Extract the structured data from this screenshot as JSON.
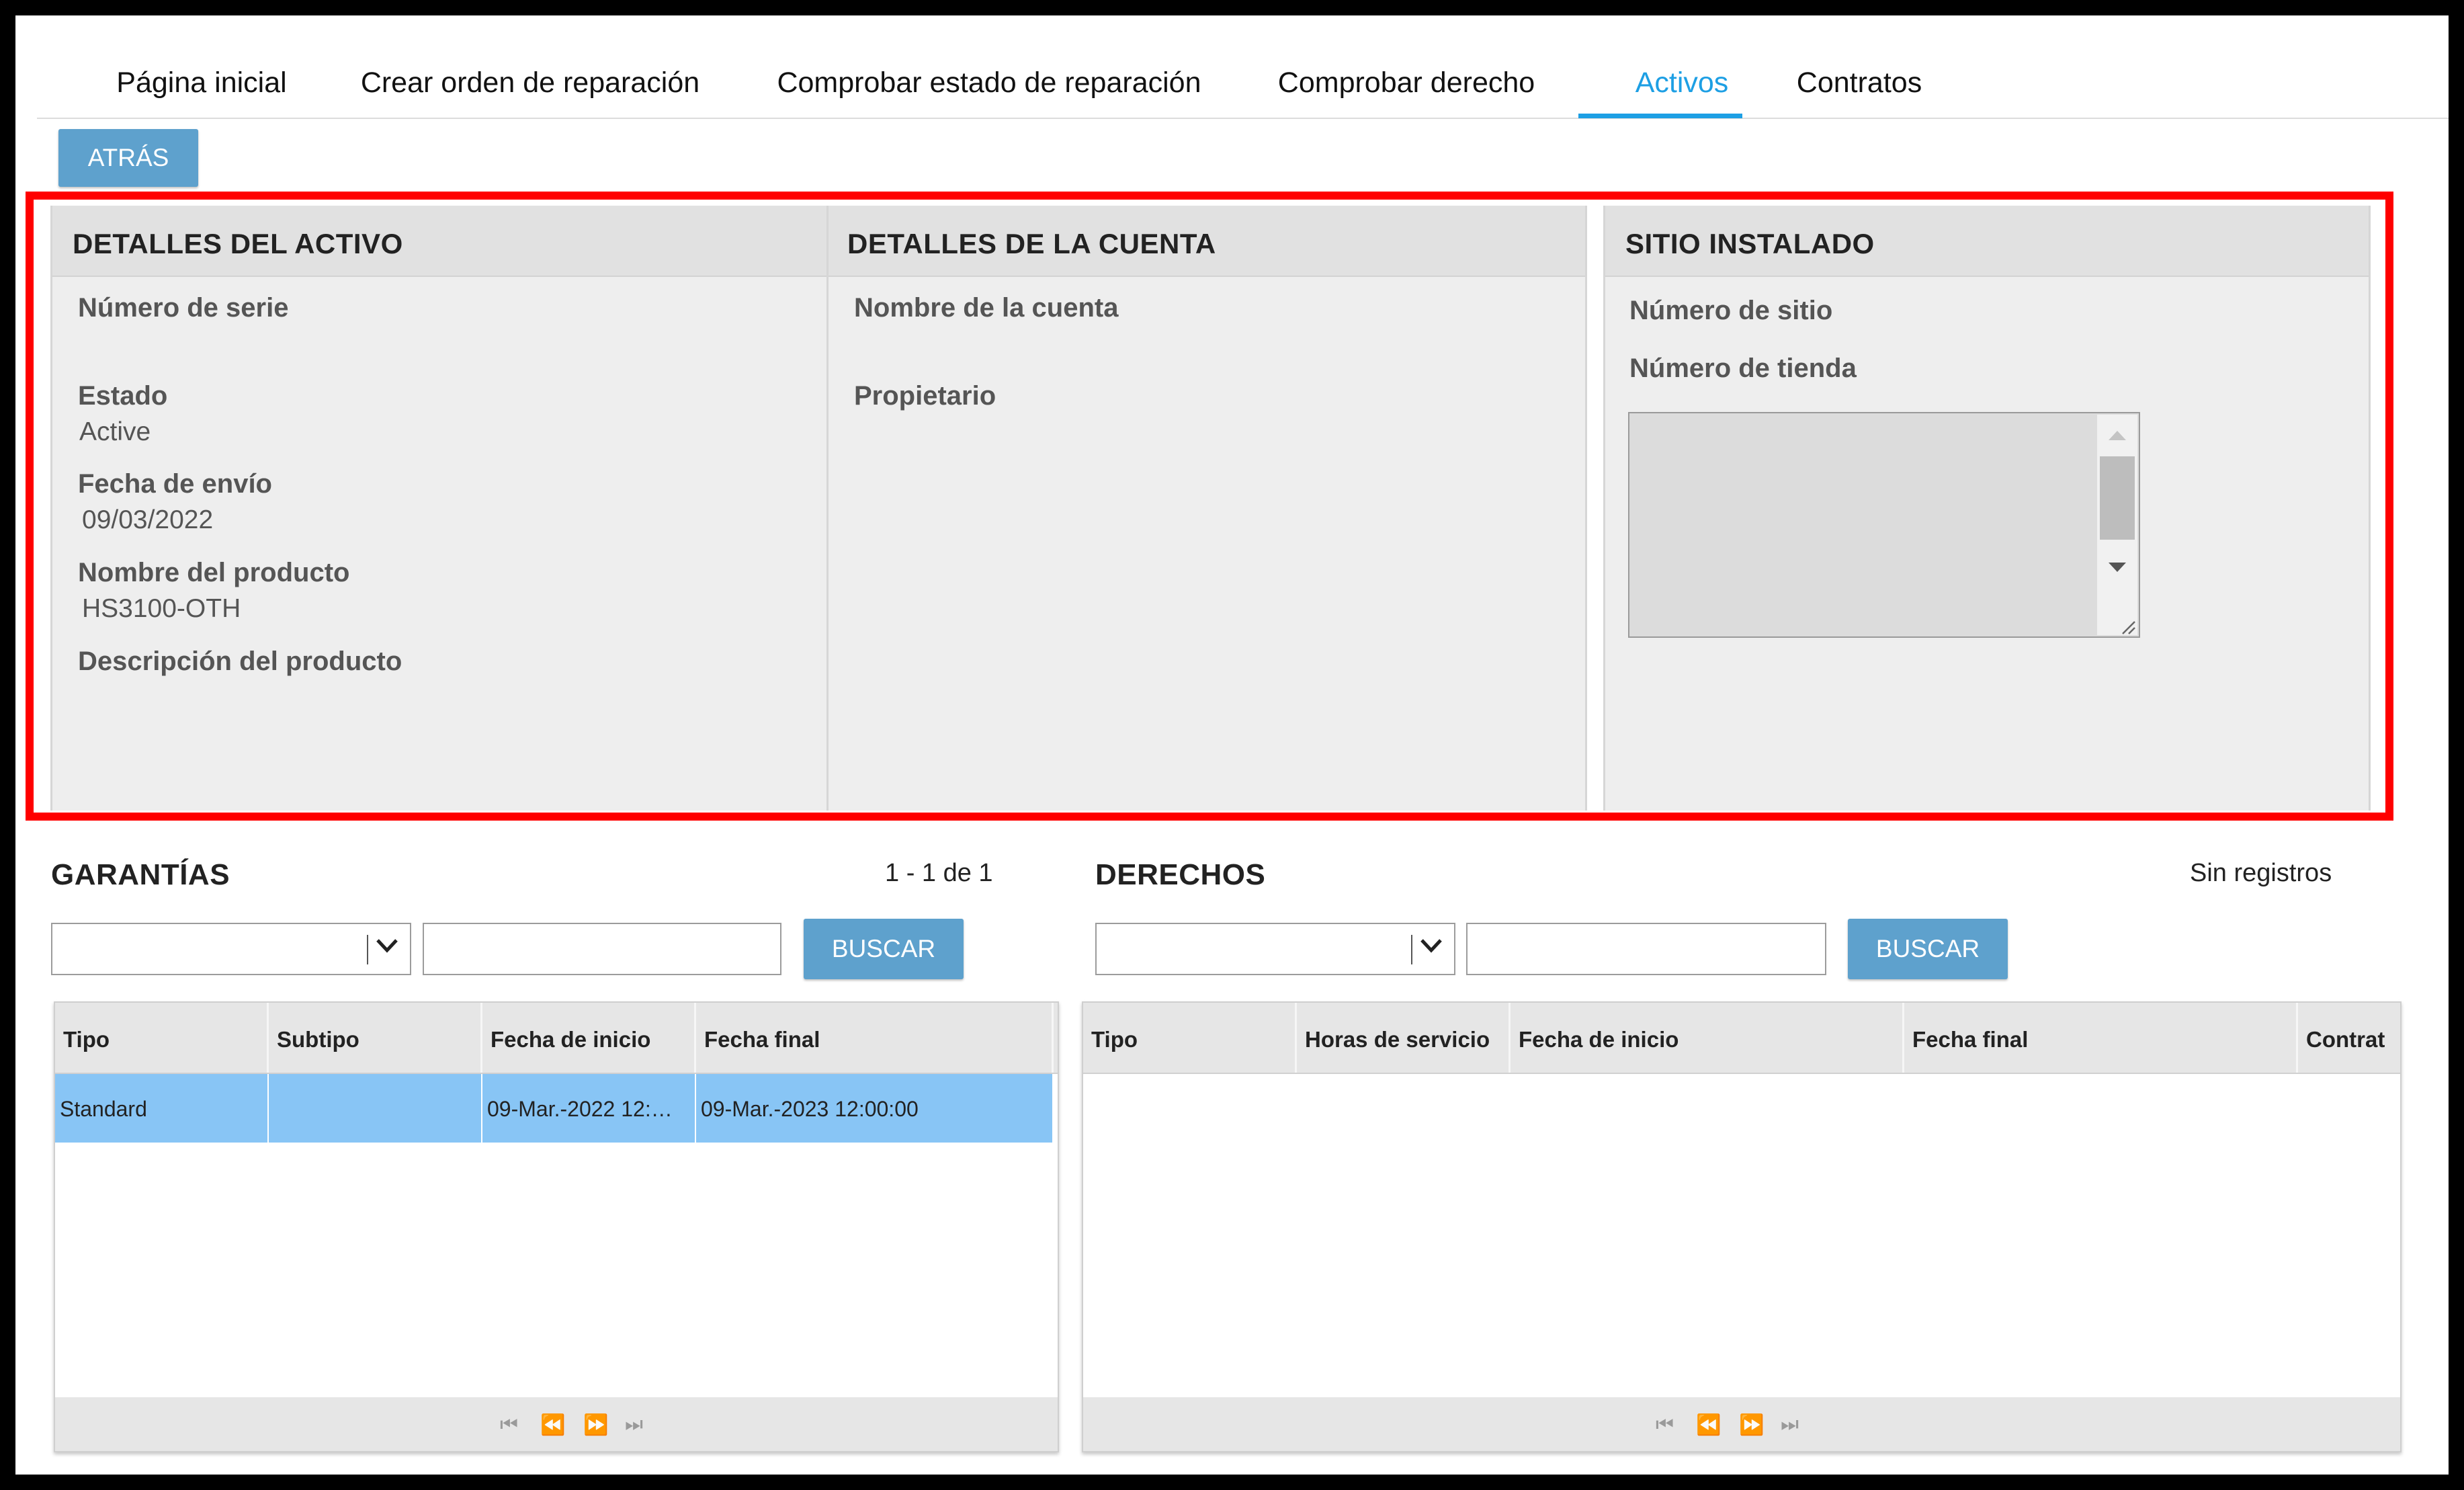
{
  "nav": {
    "tabs": [
      {
        "label": "Página inicial"
      },
      {
        "label": "Crear orden de reparación"
      },
      {
        "label": "Comprobar estado de reparación"
      },
      {
        "label": "Comprobar derecho"
      },
      {
        "label": "Activos"
      },
      {
        "label": "Contratos"
      }
    ],
    "active_tab": "Activos",
    "accent_color": "#1d9fe4"
  },
  "back_button": "ATRÁS",
  "asset_details": {
    "title": "DETALLES DEL ACTIVO",
    "serial_label": "Número de serie",
    "serial_value": "",
    "status_label": "Estado",
    "status_value": "Active",
    "ship_date_label": "Fecha de envío",
    "ship_date_value": "09/03/2022",
    "product_name_label": "Nombre del producto",
    "product_name_value": "HS3100-OTH",
    "product_desc_label": "Descripción del producto",
    "product_desc_value": ""
  },
  "account_details": {
    "title": "DETALLES DE LA CUENTA",
    "account_name_label": "Nombre de la cuenta",
    "owner_label": "Propietario"
  },
  "installed_site": {
    "title": "SITIO INSTALADO",
    "site_number_label": "Número de sitio",
    "store_number_label": "Número de tienda"
  },
  "warranties": {
    "title": "GARANTÍAS",
    "count": "1 - 1 de 1",
    "search_button": "BUSCAR",
    "columns": [
      "Tipo",
      "Subtipo",
      "Fecha de inicio",
      "Fecha final"
    ],
    "rows": [
      {
        "tipo": "Standard",
        "subtipo": "",
        "inicio": "09-Mar.-2022 12:…",
        "final": "09-Mar.-2023 12:00:00"
      }
    ]
  },
  "entitlements": {
    "title": "DERECHOS",
    "count": "Sin registros",
    "search_button": "BUSCAR",
    "columns": [
      "Tipo",
      "Horas de servicio",
      "Fecha de inicio",
      "Fecha final",
      "Contrat"
    ]
  },
  "colors": {
    "highlight_border": "#ff0000",
    "button": "#5ea1cd",
    "selected_row": "#88c5f5"
  }
}
